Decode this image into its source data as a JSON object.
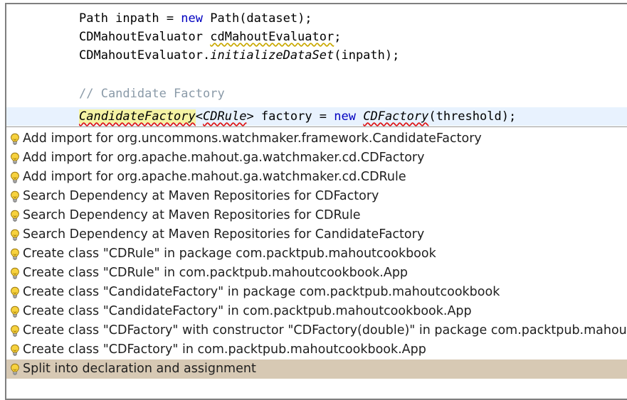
{
  "editor": {
    "lines": [
      {
        "id": "line1",
        "parts": [
          {
            "text": "Path inpath = ",
            "style": ""
          },
          {
            "text": "new",
            "style": "kw-blue"
          },
          {
            "text": " Path(dataset);",
            "style": ""
          }
        ]
      },
      {
        "id": "line2",
        "parts": [
          {
            "text": "CDMahoutEvaluator ",
            "style": ""
          },
          {
            "text": "cdMahoutEvaluator",
            "style": "warn"
          },
          {
            "text": ";",
            "style": ""
          }
        ]
      },
      {
        "id": "line3",
        "parts": [
          {
            "text": "CDMahoutEvaluator.",
            "style": ""
          },
          {
            "text": "initializeDataSet",
            "style": "italic"
          },
          {
            "text": "(inpath);",
            "style": ""
          }
        ]
      },
      {
        "id": "line4",
        "parts": [
          {
            "text": "",
            "style": ""
          }
        ]
      },
      {
        "id": "line5",
        "parts": [
          {
            "text": "// Candidate Factory",
            "style": "comment"
          }
        ]
      },
      {
        "id": "line6",
        "parts": [
          {
            "text": "CandidateFactory",
            "style": "err italic hl-yellow"
          },
          {
            "text": "<",
            "style": ""
          },
          {
            "text": "CDRule",
            "style": "err italic"
          },
          {
            "text": "> factory = ",
            "style": ""
          },
          {
            "text": "new",
            "style": "kw-blue"
          },
          {
            "text": " ",
            "style": ""
          },
          {
            "text": "CDFactory",
            "style": "err italic"
          },
          {
            "text": "(threshold);",
            "style": ""
          }
        ]
      }
    ]
  },
  "proposals": {
    "items": [
      {
        "label": "Add import for org.uncommons.watchmaker.framework.CandidateFactory",
        "selected": false
      },
      {
        "label": "Add import for org.apache.mahout.ga.watchmaker.cd.CDFactory",
        "selected": false
      },
      {
        "label": "Add import for org.apache.mahout.ga.watchmaker.cd.CDRule",
        "selected": false
      },
      {
        "label": "Search Dependency at Maven Repositories for CDFactory",
        "selected": false
      },
      {
        "label": "Search Dependency at Maven Repositories for CDRule",
        "selected": false
      },
      {
        "label": "Search Dependency at Maven Repositories for CandidateFactory",
        "selected": false
      },
      {
        "label": "Create class \"CDRule\" in package com.packtpub.mahoutcookbook",
        "selected": false
      },
      {
        "label": "Create class \"CDRule\" in com.packtpub.mahoutcookbook.App",
        "selected": false
      },
      {
        "label": "Create class \"CandidateFactory\" in package com.packtpub.mahoutcookbook",
        "selected": false
      },
      {
        "label": "Create class \"CandidateFactory\" in com.packtpub.mahoutcookbook.App",
        "selected": false
      },
      {
        "label": "Create class \"CDFactory\" with constructor \"CDFactory(double)\" in package com.packtpub.mahoutcookbook",
        "selected": false
      },
      {
        "label": "Create class \"CDFactory\" in com.packtpub.mahoutcookbook.App",
        "selected": false
      },
      {
        "label": "Split into declaration and assignment",
        "selected": true
      }
    ],
    "icon": "lightbulb-icon",
    "selected_color": "#d7c9b4"
  }
}
